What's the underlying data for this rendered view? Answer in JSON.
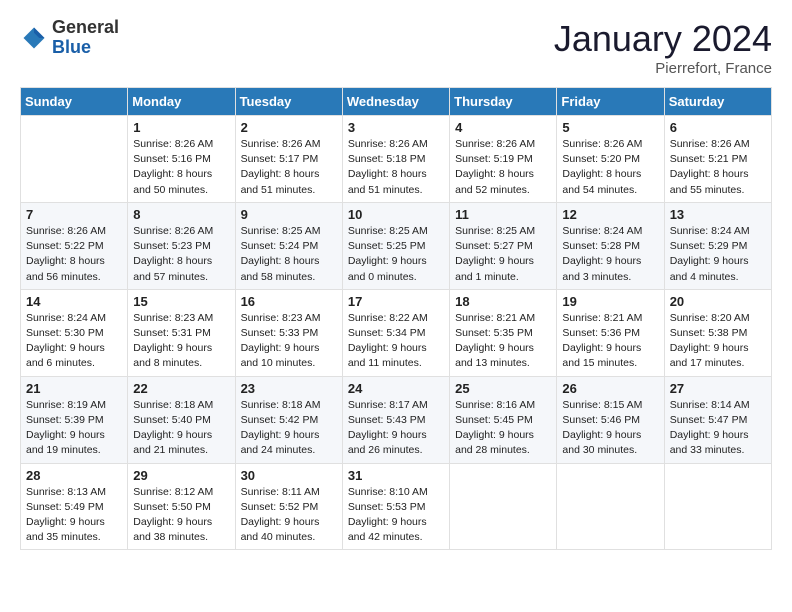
{
  "header": {
    "logo_general": "General",
    "logo_blue": "Blue",
    "month_title": "January 2024",
    "subtitle": "Pierrefort, France"
  },
  "days_of_week": [
    "Sunday",
    "Monday",
    "Tuesday",
    "Wednesday",
    "Thursday",
    "Friday",
    "Saturday"
  ],
  "weeks": [
    [
      {
        "day": "",
        "info": ""
      },
      {
        "day": "1",
        "info": "Sunrise: 8:26 AM\nSunset: 5:16 PM\nDaylight: 8 hours\nand 50 minutes."
      },
      {
        "day": "2",
        "info": "Sunrise: 8:26 AM\nSunset: 5:17 PM\nDaylight: 8 hours\nand 51 minutes."
      },
      {
        "day": "3",
        "info": "Sunrise: 8:26 AM\nSunset: 5:18 PM\nDaylight: 8 hours\nand 51 minutes."
      },
      {
        "day": "4",
        "info": "Sunrise: 8:26 AM\nSunset: 5:19 PM\nDaylight: 8 hours\nand 52 minutes."
      },
      {
        "day": "5",
        "info": "Sunrise: 8:26 AM\nSunset: 5:20 PM\nDaylight: 8 hours\nand 54 minutes."
      },
      {
        "day": "6",
        "info": "Sunrise: 8:26 AM\nSunset: 5:21 PM\nDaylight: 8 hours\nand 55 minutes."
      }
    ],
    [
      {
        "day": "7",
        "info": "Sunrise: 8:26 AM\nSunset: 5:22 PM\nDaylight: 8 hours\nand 56 minutes."
      },
      {
        "day": "8",
        "info": "Sunrise: 8:26 AM\nSunset: 5:23 PM\nDaylight: 8 hours\nand 57 minutes."
      },
      {
        "day": "9",
        "info": "Sunrise: 8:25 AM\nSunset: 5:24 PM\nDaylight: 8 hours\nand 58 minutes."
      },
      {
        "day": "10",
        "info": "Sunrise: 8:25 AM\nSunset: 5:25 PM\nDaylight: 9 hours\nand 0 minutes."
      },
      {
        "day": "11",
        "info": "Sunrise: 8:25 AM\nSunset: 5:27 PM\nDaylight: 9 hours\nand 1 minute."
      },
      {
        "day": "12",
        "info": "Sunrise: 8:24 AM\nSunset: 5:28 PM\nDaylight: 9 hours\nand 3 minutes."
      },
      {
        "day": "13",
        "info": "Sunrise: 8:24 AM\nSunset: 5:29 PM\nDaylight: 9 hours\nand 4 minutes."
      }
    ],
    [
      {
        "day": "14",
        "info": "Sunrise: 8:24 AM\nSunset: 5:30 PM\nDaylight: 9 hours\nand 6 minutes."
      },
      {
        "day": "15",
        "info": "Sunrise: 8:23 AM\nSunset: 5:31 PM\nDaylight: 9 hours\nand 8 minutes."
      },
      {
        "day": "16",
        "info": "Sunrise: 8:23 AM\nSunset: 5:33 PM\nDaylight: 9 hours\nand 10 minutes."
      },
      {
        "day": "17",
        "info": "Sunrise: 8:22 AM\nSunset: 5:34 PM\nDaylight: 9 hours\nand 11 minutes."
      },
      {
        "day": "18",
        "info": "Sunrise: 8:21 AM\nSunset: 5:35 PM\nDaylight: 9 hours\nand 13 minutes."
      },
      {
        "day": "19",
        "info": "Sunrise: 8:21 AM\nSunset: 5:36 PM\nDaylight: 9 hours\nand 15 minutes."
      },
      {
        "day": "20",
        "info": "Sunrise: 8:20 AM\nSunset: 5:38 PM\nDaylight: 9 hours\nand 17 minutes."
      }
    ],
    [
      {
        "day": "21",
        "info": "Sunrise: 8:19 AM\nSunset: 5:39 PM\nDaylight: 9 hours\nand 19 minutes."
      },
      {
        "day": "22",
        "info": "Sunrise: 8:18 AM\nSunset: 5:40 PM\nDaylight: 9 hours\nand 21 minutes."
      },
      {
        "day": "23",
        "info": "Sunrise: 8:18 AM\nSunset: 5:42 PM\nDaylight: 9 hours\nand 24 minutes."
      },
      {
        "day": "24",
        "info": "Sunrise: 8:17 AM\nSunset: 5:43 PM\nDaylight: 9 hours\nand 26 minutes."
      },
      {
        "day": "25",
        "info": "Sunrise: 8:16 AM\nSunset: 5:45 PM\nDaylight: 9 hours\nand 28 minutes."
      },
      {
        "day": "26",
        "info": "Sunrise: 8:15 AM\nSunset: 5:46 PM\nDaylight: 9 hours\nand 30 minutes."
      },
      {
        "day": "27",
        "info": "Sunrise: 8:14 AM\nSunset: 5:47 PM\nDaylight: 9 hours\nand 33 minutes."
      }
    ],
    [
      {
        "day": "28",
        "info": "Sunrise: 8:13 AM\nSunset: 5:49 PM\nDaylight: 9 hours\nand 35 minutes."
      },
      {
        "day": "29",
        "info": "Sunrise: 8:12 AM\nSunset: 5:50 PM\nDaylight: 9 hours\nand 38 minutes."
      },
      {
        "day": "30",
        "info": "Sunrise: 8:11 AM\nSunset: 5:52 PM\nDaylight: 9 hours\nand 40 minutes."
      },
      {
        "day": "31",
        "info": "Sunrise: 8:10 AM\nSunset: 5:53 PM\nDaylight: 9 hours\nand 42 minutes."
      },
      {
        "day": "",
        "info": ""
      },
      {
        "day": "",
        "info": ""
      },
      {
        "day": "",
        "info": ""
      }
    ]
  ]
}
